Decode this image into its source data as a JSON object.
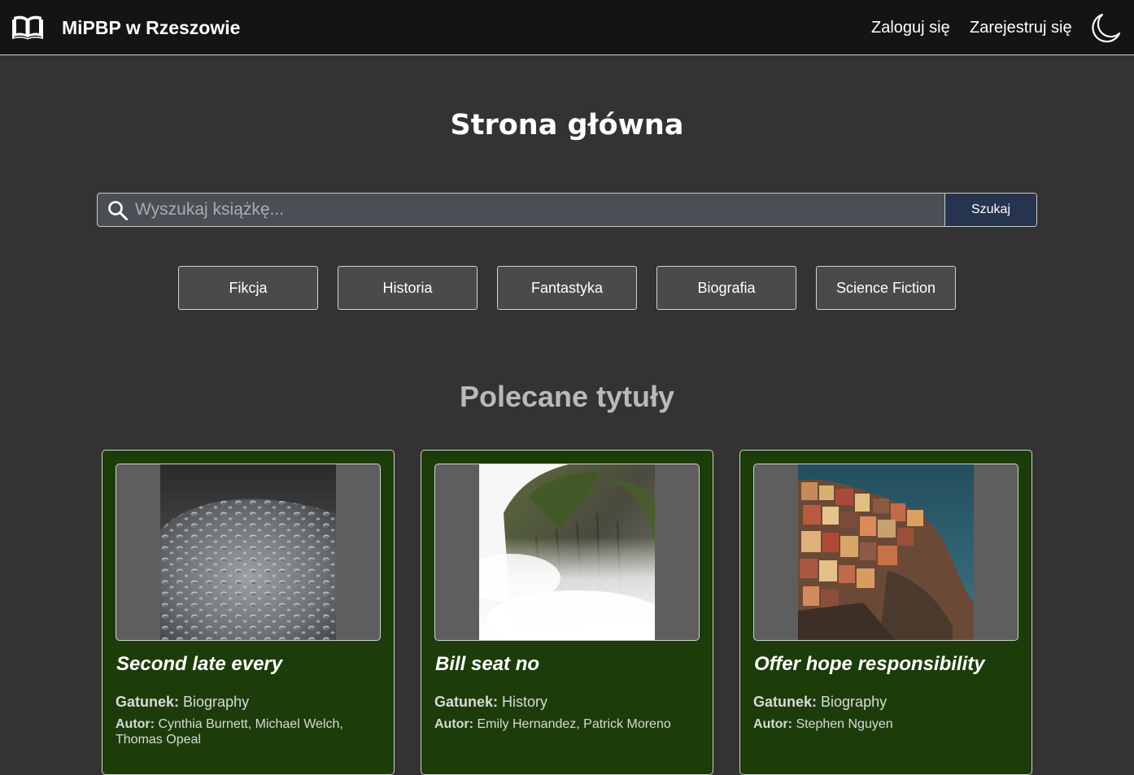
{
  "navbar": {
    "brand_name": "MiPBP w Rzeszowie",
    "login_label": "Zaloguj się",
    "register_label": "Zarejestruj się",
    "theme_icon": "moon-icon",
    "logo_icon": "open-book-icon"
  },
  "main": {
    "page_title": "Strona główna",
    "search": {
      "placeholder": "Wyszukaj książkę...",
      "value": "",
      "button_label": "Szukaj",
      "icon": "search-icon"
    },
    "genres": [
      "Fikcja",
      "Historia",
      "Fantastyka",
      "Biografia",
      "Science Fiction"
    ],
    "featured_title": "Polecane tytuły",
    "books": [
      {
        "title": "Second late every",
        "genre_label": "Gatunek:",
        "genre": "Biography",
        "author_label": "Autor:",
        "author": "Cynthia Burnett, Michael Welch, Thomas Opeal",
        "image": "water-droplets-photo"
      },
      {
        "title": "Bill seat no",
        "genre_label": "Gatunek:",
        "genre": "History",
        "author_label": "Autor:",
        "author": "Emily Hernandez, Patrick Moreno",
        "image": "misty-cliff-photo"
      },
      {
        "title": "Offer hope responsibility",
        "genre_label": "Gatunek:",
        "genre": "Biography",
        "author_label": "Autor:",
        "author": "Stephen Nguyen",
        "image": "cliffside-village-photo"
      }
    ]
  },
  "colors": {
    "navbar_bg": "#141414",
    "page_bg": "#333333",
    "card_bg": "#1c3d0a",
    "search_button_bg": "#26344f",
    "genre_button_bg": "#4a4a4a"
  }
}
